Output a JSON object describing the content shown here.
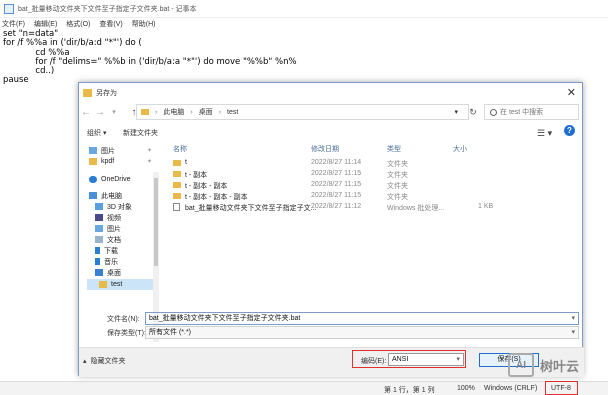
{
  "notepad": {
    "title": "bat_批量移动文件夹下文件至子指定子文件夹.bat - 记事本",
    "menu": [
      "文件(F)",
      "编辑(E)",
      "格式(O)",
      "查看(V)",
      "帮助(H)"
    ],
    "lines": [
      "set \"n=data\"",
      "for /f %%a in ('dir/b/a:d \"*\"') do (",
      "            cd %%a",
      "            for /f \"delims=\" %%b in ('dir/b/a:a \"*\"') do move \"%%b\" %n%",
      "            cd..)",
      "pause"
    ],
    "status": {
      "position": "第 1 行，第 1 列",
      "zoom": "100%",
      "eol": "Windows (CRLF)",
      "encoding": "UTF-8"
    }
  },
  "dialog": {
    "title": "另存为",
    "breadcrumb": [
      "此电脑",
      "桌面",
      "test"
    ],
    "search_placeholder": "在 test 中搜索",
    "toolbar": {
      "organize": "组织 ▾",
      "new_folder": "新建文件夹",
      "help": "?"
    },
    "nav_items": [
      {
        "label": "图片",
        "icon": "pictures-icon",
        "pinned": true
      },
      {
        "label": "kpdf",
        "icon": "folder-icon",
        "pinned": true
      },
      {
        "label": "OneDrive",
        "icon": "onedrive-icon",
        "pinned": false
      },
      {
        "label": "此电脑",
        "icon": "pc-icon",
        "pinned": false
      },
      {
        "label": "3D 对象",
        "icon": "3d-objects-icon",
        "pinned": false
      },
      {
        "label": "视频",
        "icon": "video-icon",
        "pinned": false
      },
      {
        "label": "图片",
        "icon": "pictures-icon",
        "pinned": false
      },
      {
        "label": "文档",
        "icon": "documents-icon",
        "pinned": false
      },
      {
        "label": "下载",
        "icon": "download-icon",
        "pinned": false
      },
      {
        "label": "音乐",
        "icon": "music-icon",
        "pinned": false
      },
      {
        "label": "桌面",
        "icon": "desktop-icon",
        "pinned": false
      },
      {
        "label": "test",
        "icon": "folder-icon",
        "pinned": false
      }
    ],
    "columns": {
      "name": "名称",
      "modified": "修改日期",
      "type": "类型",
      "size": "大小"
    },
    "files": [
      {
        "name": "t",
        "modified": "2022/8/27 11:14",
        "type": "文件夹",
        "size": ""
      },
      {
        "name": "t - 副本",
        "modified": "2022/8/27 11:15",
        "type": "文件夹",
        "size": ""
      },
      {
        "name": "t - 副本 - 副本",
        "modified": "2022/8/27 11:15",
        "type": "文件夹",
        "size": ""
      },
      {
        "name": "t - 副本 - 副本 - 副本",
        "modified": "2022/8/27 11:15",
        "type": "文件夹",
        "size": ""
      },
      {
        "name": "bat_批量移动文件夹下文件至子指定子文...",
        "modified": "2022/8/27 11:12",
        "type": "Windows 批处理...",
        "size": "1 KB"
      }
    ],
    "filename_label": "文件名(N):",
    "filename_value": "bat_批量移动文件夹下文件至子指定子文件夹.bat",
    "filetype_label": "保存类型(T):",
    "filetype_value": "所有文件 (*.*)",
    "hide_folders": "隐藏文件夹",
    "encoding_label": "编码(E):",
    "encoding_value": "ANSI",
    "save_button": "保存(S)"
  },
  "watermark": {
    "logo": "AI",
    "text": "树叶云"
  },
  "colors": {
    "highlight": "#e03030",
    "accent": "#1e6fd0",
    "folder": "#e9b94a"
  }
}
